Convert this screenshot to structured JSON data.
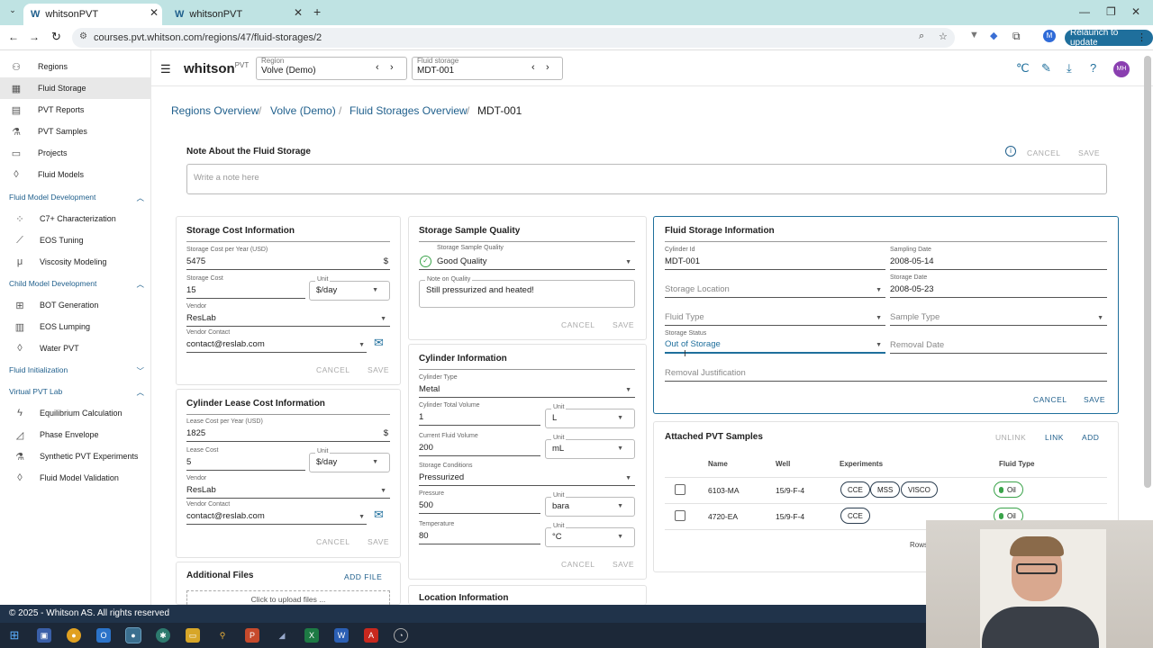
{
  "browser": {
    "tabs": [
      {
        "label": "whitsonPVT"
      },
      {
        "label": "whitsonPVT"
      }
    ],
    "url": "courses.pvt.whitson.com/regions/47/fluid-storages/2",
    "relaunch": "Relaunch to update",
    "profile_initial": "M"
  },
  "header": {
    "logo": "whitson",
    "logo_sup": "PVT",
    "region_label": "Region",
    "region_value": "Volve (Demo)",
    "storage_label": "Fluid storage",
    "storage_value": "MDT-001",
    "avatar": "MH"
  },
  "sidebar": {
    "items": [
      {
        "label": "Regions",
        "icon": "tree-icon"
      },
      {
        "label": "Fluid Storage",
        "icon": "storage-icon"
      },
      {
        "label": "PVT Reports",
        "icon": "report-icon"
      },
      {
        "label": "PVT Samples",
        "icon": "flask-icon"
      },
      {
        "label": "Projects",
        "icon": "folder-icon"
      },
      {
        "label": "Fluid Models",
        "icon": "drop-icon"
      }
    ],
    "groups": [
      {
        "label": "Fluid Model Development",
        "items": [
          "C7+ Characterization",
          "EOS Tuning",
          "Viscosity Modeling"
        ]
      },
      {
        "label": "Child Model Development",
        "items": [
          "BOT Generation",
          "EOS Lumping",
          "Water PVT"
        ]
      },
      {
        "label": "Fluid Initialization",
        "items": []
      },
      {
        "label": "Virtual PVT Lab",
        "items": [
          "Equilibrium Calculation",
          "Phase Envelope",
          "Synthetic PVT Experiments",
          "Fluid Model Validation"
        ]
      }
    ]
  },
  "breadcrumb": [
    "Regions Overview",
    "Volve (Demo)",
    "Fluid Storages Overview",
    "MDT-001"
  ],
  "note": {
    "title": "Note About the Fluid Storage",
    "placeholder": "Write a note here",
    "cancel": "CANCEL",
    "save": "SAVE"
  },
  "cost": {
    "title": "Storage Cost Information",
    "per_year_label": "Storage Cost per Year (USD)",
    "per_year": "5475",
    "currency": "$",
    "cost_label": "Storage Cost",
    "cost": "15",
    "unit_label": "Unit",
    "unit": "$/day",
    "vendor_label": "Vendor",
    "vendor": "ResLab",
    "contact_label": "Vendor Contact",
    "contact": "contact@reslab.com",
    "cancel": "CANCEL",
    "save": "SAVE"
  },
  "lease": {
    "title": "Cylinder Lease Cost Information",
    "per_year_label": "Lease Cost per Year (USD)",
    "per_year": "1825",
    "currency": "$",
    "cost_label": "Lease Cost",
    "cost": "5",
    "unit_label": "Unit",
    "unit": "$/day",
    "vendor_label": "Vendor",
    "vendor": "ResLab",
    "contact_label": "Vendor Contact",
    "contact": "contact@reslab.com",
    "cancel": "CANCEL",
    "save": "SAVE"
  },
  "files": {
    "title": "Additional Files",
    "add": "ADD FILE",
    "upload": "Click to upload files ..."
  },
  "quality": {
    "title": "Storage Sample Quality",
    "quality_label": "Storage Sample Quality",
    "quality": "Good Quality",
    "note_label": "Note on Quality",
    "note": "Still pressurized and heated!",
    "cancel": "CANCEL",
    "save": "SAVE"
  },
  "cylinder": {
    "title": "Cylinder Information",
    "type_label": "Cylinder Type",
    "type": "Metal",
    "total_label": "Cylinder Total Volume",
    "total": "1",
    "total_unit": "L",
    "current_label": "Current Fluid Volume",
    "current": "200",
    "current_unit": "mL",
    "cond_label": "Storage Conditions",
    "cond": "Pressurized",
    "pressure_label": "Pressure",
    "pressure": "500",
    "pressure_unit": "bara",
    "temp_label": "Temperature",
    "temp": "80",
    "temp_unit": "°C",
    "unit_label": "Unit",
    "cancel": "CANCEL",
    "save": "SAVE"
  },
  "location": {
    "title": "Location Information"
  },
  "storage_info": {
    "title": "Fluid Storage Information",
    "cyl_label": "Cylinder Id",
    "cyl": "MDT-001",
    "sdate_label": "Sampling Date",
    "sdate": "2008-05-14",
    "loc_placeholder": "Storage Location",
    "stdate_label": "Storage Date",
    "stdate": "2008-05-23",
    "fluid_type_placeholder": "Fluid Type",
    "sample_type_placeholder": "Sample Type",
    "status_label": "Storage Status",
    "status": "Out of Storage",
    "removal_placeholder": "Removal Date",
    "justification_placeholder": "Removal Justification",
    "cancel": "CANCEL",
    "save": "SAVE"
  },
  "samples": {
    "title": "Attached PVT Samples",
    "unlink": "UNLINK",
    "link": "LINK",
    "add": "ADD",
    "columns": [
      "Name",
      "Well",
      "Experiments",
      "Fluid Type"
    ],
    "rows": [
      {
        "name": "6103-MA",
        "well": "15/9-F-4",
        "experiments": [
          "CCE",
          "MSS",
          "VISCO"
        ],
        "fluid": "Oil"
      },
      {
        "name": "4720-EA",
        "well": "15/9-F-4",
        "experiments": [
          "CCE"
        ],
        "fluid": "Oil"
      }
    ],
    "rows_label": "Rows"
  },
  "footer": "© 2025 - Whitson AS. All rights reserved"
}
